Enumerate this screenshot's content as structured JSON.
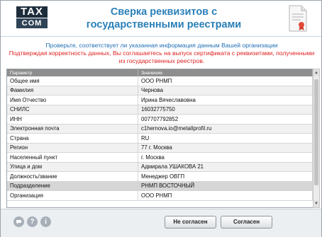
{
  "logo": {
    "line1": "TAX",
    "line2": "COM"
  },
  "title": "Сверка реквизитов с государственными реестрами",
  "notice": {
    "line1": "Проверьте, соответствует ли указанная информация данным Вашей организации",
    "line2": "Подтверждая корректность данных, Вы соглашаетесь на выпуск сертификата с реквизитами, полученными из государственных реестров."
  },
  "table": {
    "headers": [
      "Параметр",
      "Значение"
    ],
    "rows": [
      {
        "param": "Общее имя",
        "value": "ООО РНМП"
      },
      {
        "param": "Фамилия",
        "value": "Чернова"
      },
      {
        "param": "Имя Отчество",
        "value": "Ирина Вячеславовна"
      },
      {
        "param": "СНИЛС",
        "value": "16032775750"
      },
      {
        "param": "ИНН",
        "value": "007707792852"
      },
      {
        "param": "Электронная почта",
        "value": "c1hernova.io@metallprofil.ru"
      },
      {
        "param": "Страна",
        "value": "RU"
      },
      {
        "param": "Регион",
        "value": "77 г. Москва"
      },
      {
        "param": "Населенный пункт",
        "value": "г. Москва"
      },
      {
        "param": "Улица и дом",
        "value": "Адмирала УШАКОВА 21"
      },
      {
        "param": "Должность/звание",
        "value": "Менеджер ОВГП"
      },
      {
        "param": "Подразделение",
        "value": "РНМП ВОСТОЧНЫЙ"
      },
      {
        "param": "Организация",
        "value": "ООО РНМП"
      }
    ],
    "selected_row": "Подразделение"
  },
  "footer": {
    "icons": [
      {
        "name": "chat-icon",
        "glyph": "💬"
      },
      {
        "name": "help-icon",
        "glyph": "?"
      },
      {
        "name": "info-icon",
        "glyph": "i"
      }
    ],
    "disagree_label": "Не согласен",
    "agree_label": "Согласен"
  },
  "colors": {
    "accent": "#2a7fb8",
    "warning": "#e02020",
    "notice_blue": "#1f6fb5"
  }
}
